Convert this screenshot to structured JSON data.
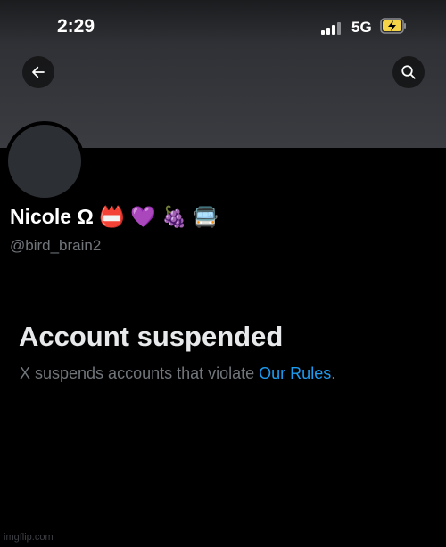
{
  "status_bar": {
    "time": "2:29",
    "network": "5G"
  },
  "header": {
    "back_icon": "arrow-left-icon",
    "search_icon": "search-icon"
  },
  "profile": {
    "display_name": "Nicole Ω",
    "name_emojis": [
      "📛",
      "💜",
      "🍇",
      "🚍"
    ],
    "handle": "@bird_brain2"
  },
  "suspension": {
    "title": "Account suspended",
    "description_prefix": "X suspends accounts that violate ",
    "rules_link": "Our Rules",
    "description_suffix": "."
  },
  "watermark": "imgflip.com",
  "colors": {
    "accent": "#1d9bf0",
    "secondary_text": "#71767b",
    "background": "#000000"
  }
}
